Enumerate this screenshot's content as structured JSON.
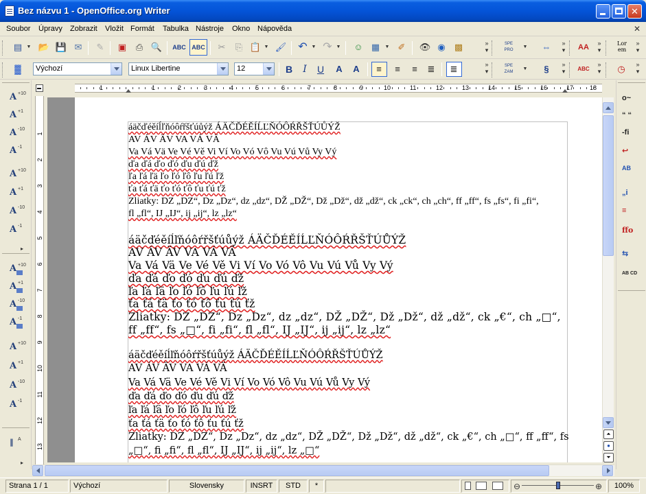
{
  "window": {
    "title": "Bez názvu 1 - OpenOffice.org Writer",
    "minimize_icon": "minimize-icon",
    "maximize_icon": "maximize-icon",
    "close_icon": "close-icon"
  },
  "menu": [
    "Soubor",
    "Úpravy",
    "Zobrazit",
    "Vložit",
    "Formát",
    "Tabulka",
    "Nástroje",
    "Okno",
    "Nápověda"
  ],
  "menu_close_doc": "✕",
  "formatting": {
    "style": "Výchozí",
    "font": "Linux Libertine",
    "size": "12"
  },
  "ruler": {
    "numbers": [
      "1",
      "1",
      "2",
      "3",
      "4",
      "5",
      "6",
      "7",
      "8",
      "9",
      "10",
      "11",
      "12",
      "13",
      "14",
      "15",
      "16",
      "17",
      "18"
    ]
  },
  "vruler": {
    "numbers": [
      "1",
      "2",
      "3",
      "4",
      "5",
      "6",
      "7",
      "8",
      "9",
      "10",
      "11",
      "12",
      "13"
    ]
  },
  "document": {
    "block1": [
      "áäčďéěíĺľňóôŕřšťúůýž ÁÄČĎÉĚÍĹĽŇÓÔŔŘŠŤÚŮÝŽ",
      "AV ÁV ÄV VA VÁ VÄ",
      "Va Vá Vä Ve Vé Vě Vi Ví Vo Vó Vô Vu Vú Vů Vy Vý",
      "ďa ďá ďo ďó ďu ďú ďž",
      "ľa ľá ľä ľo ľó ľô ľu ľú ľž",
      "ťa ťá ťä ťo ťó ťô ťu ťú ťž",
      "Zliatky: DZ „DZ“, Dz „Dz“, dz „dz“, DŽ „DŽ“, Dž „Dž“, dž „dž“, ck „ck“, ch „ch“, ff „ff“, fs „fs“, fi „fi“,",
      "fl „fl“, IJ „IJ“, ij „ij“, lz „lz“"
    ],
    "block2": [
      "áäčďéěíĺľňóôŕřšťúůýž ÁÄČĎÉĚÍĹĽŇÓÔŔŘŠŤÚŮÝŽ",
      "AV ÁV ÄV VA VÁ VÄ",
      "Va Vá Vä Ve Vé Vě Vi Ví Vo Vó Vô Vu Vú Vů Vy Vý",
      "ďa ďá ďo ďó ďu ďú ďž",
      "ľa ľá ľä ľo ľó ľô ľu ľú ľž",
      "ťa ťá ťä ťo ťó ťô ťu ťú ťž",
      "Zliatky: DZ „DZ“, Dz „Dz“, dz „dz“, DŽ „DŽ“, Dž „Dž“, dž „dž“, ck „€“, ch „□“,",
      "ff „ff“, fs „□“, fi „fi“, fl „fl“, IJ „IJ“, ij „ij“, lz „lz“"
    ],
    "block3": [
      "áäčďéěíĺľňóôŕřšťúůýž ÁÄČĎÉĚÍĹĽŇÓÔŔŘŠŤÚŮÝŽ",
      "AV ÁV ÄV VA VÁ VÄ",
      "Va Vá Vä Ve Vé Vě Vi Ví Vo Vó Vô Vu Vú Vů Vy Vý",
      "ďa ďá ďo ďó ďu ďú ďž",
      "ľa ľá ľä ľo ľó ľô ľu ľú ľž",
      "ťa ťá ťä ťo ťó ťô ťu ťú ťž",
      "Zliatky: DZ „DZ“, Dz „Dz“, dz „dz“, DŽ „DŽ“, Dž „Dž“, dž „dž“, ck „€“, ch „□“, ff „ff“, fs",
      "„□“, fi „fi“, fl „fl“, IJ „IJ“, ij „ij“, lz „□“"
    ]
  },
  "status": {
    "page": "Strana 1 / 1",
    "style": "Výchozí",
    "language": "Slovensky",
    "insert": "INSRT",
    "selection": "STD",
    "modified": "*",
    "zoom": "100%"
  },
  "right_toolbar_labels": [
    "o~",
    "“ “",
    "-fi",
    "↩",
    "AB",
    "„i",
    "≡",
    "ffo",
    "⇆",
    "AB CD"
  ],
  "toolbar_top_labels": {
    "spe": "SPE PRO",
    "lorem": "Lor em"
  },
  "toolbar_fmt_labels": {
    "spe": "SPE ZAM",
    "bold": "B",
    "italic": "I",
    "underline": "U"
  }
}
